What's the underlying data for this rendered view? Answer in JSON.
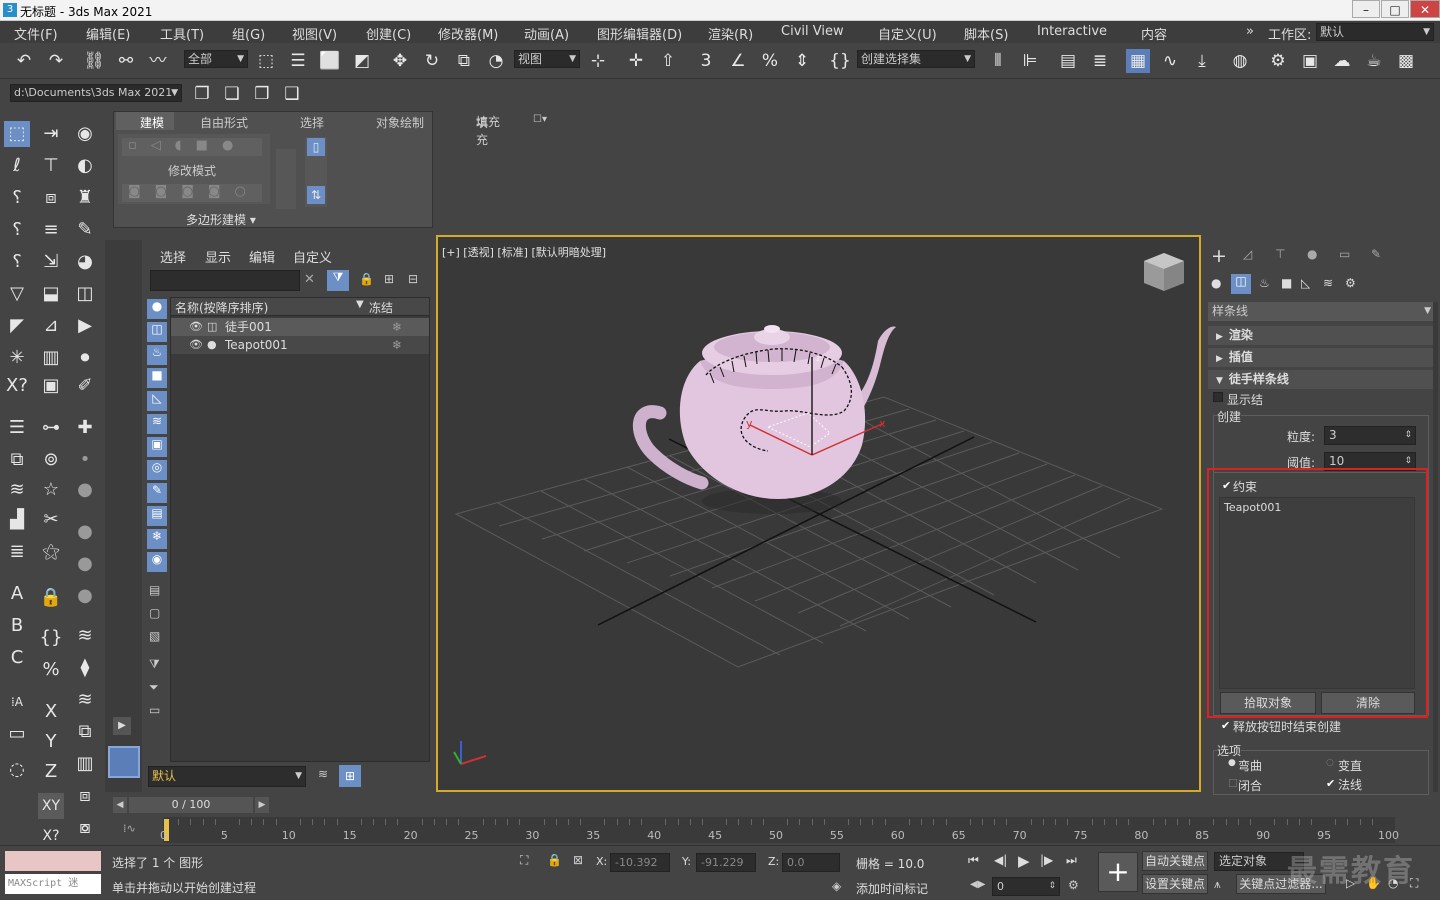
{
  "window": {
    "title": "无标题 - 3ds Max 2021",
    "app_icon": "3",
    "controls": [
      "–",
      "□",
      "✕"
    ]
  },
  "menu": [
    "文件(F)",
    "编辑(E)",
    "工具(T)",
    "组(G)",
    "视图(V)",
    "创建(C)",
    "修改器(M)",
    "动画(A)",
    "图形编辑器(D)",
    "渲染(R)",
    "Civil View",
    "自定义(U)",
    "脚本(S)",
    "Interactive",
    "内容"
  ],
  "workspace": {
    "label": "工作区:",
    "value": "默认"
  },
  "toolbar": {
    "filter": "全部",
    "refcoord": "视图",
    "selset": "创建选择集",
    "path": "d:\\Documents\\3ds Max 2021"
  },
  "ribbon": {
    "tabs": [
      "建模",
      "自由形式",
      "选择",
      "对象绘制",
      "填充"
    ],
    "modify_mode": "修改模式",
    "poly": "多边形建模 ▾"
  },
  "scene": {
    "tabs": [
      "选择",
      "显示",
      "编辑",
      "自定义"
    ],
    "col_name": "名称(按降序排序)",
    "col_freeze": "冻结",
    "rows": [
      "徒手001",
      "Teapot001"
    ],
    "layer": "默认"
  },
  "viewport": {
    "label": "[+] [透视] [标准] [默认明暗处理]"
  },
  "cmdpanel": {
    "category": "样条线",
    "rollouts": [
      "渲染",
      "插值",
      "徒手样条线"
    ],
    "show_knots": "显示结",
    "create_group": "创建",
    "granularity_label": "粒度:",
    "granularity": "3",
    "threshold_label": "阈值:",
    "threshold": "10",
    "constrain": "约束",
    "constrain_obj": "Teapot001",
    "pick_btn": "拾取对象",
    "clear_btn": "清除",
    "release_create": "释放按钮时结束创建",
    "options_group": "选项",
    "curved": "弯曲",
    "closed": "闭合",
    "convex": "变直",
    "normals": "法线"
  },
  "time": {
    "frame": "0 / 100",
    "ticks": [
      "0",
      "5",
      "10",
      "15",
      "20",
      "25",
      "30",
      "35",
      "40",
      "45",
      "50",
      "55",
      "60",
      "65",
      "70",
      "75",
      "80",
      "85",
      "90",
      "95",
      "100"
    ]
  },
  "status": {
    "maxscript": "MAXScript 迷",
    "selected": "选择了 1 个 图形",
    "prompt": "单击并拖动以开始创建过程",
    "x_label": "X:",
    "x": "-10.392",
    "y_label": "Y:",
    "y": "-91.229",
    "z_label": "Z:",
    "z": "0.0",
    "grid": "栅格 = 10.0",
    "add_time_tag": "添加时间标记",
    "auto_key": "自动关键点",
    "set_key": "设置关键点",
    "selected_obj": "选定对象",
    "key_filter": "关键点过滤器...",
    "frame_val": "0",
    "watermark": "最需教育"
  }
}
